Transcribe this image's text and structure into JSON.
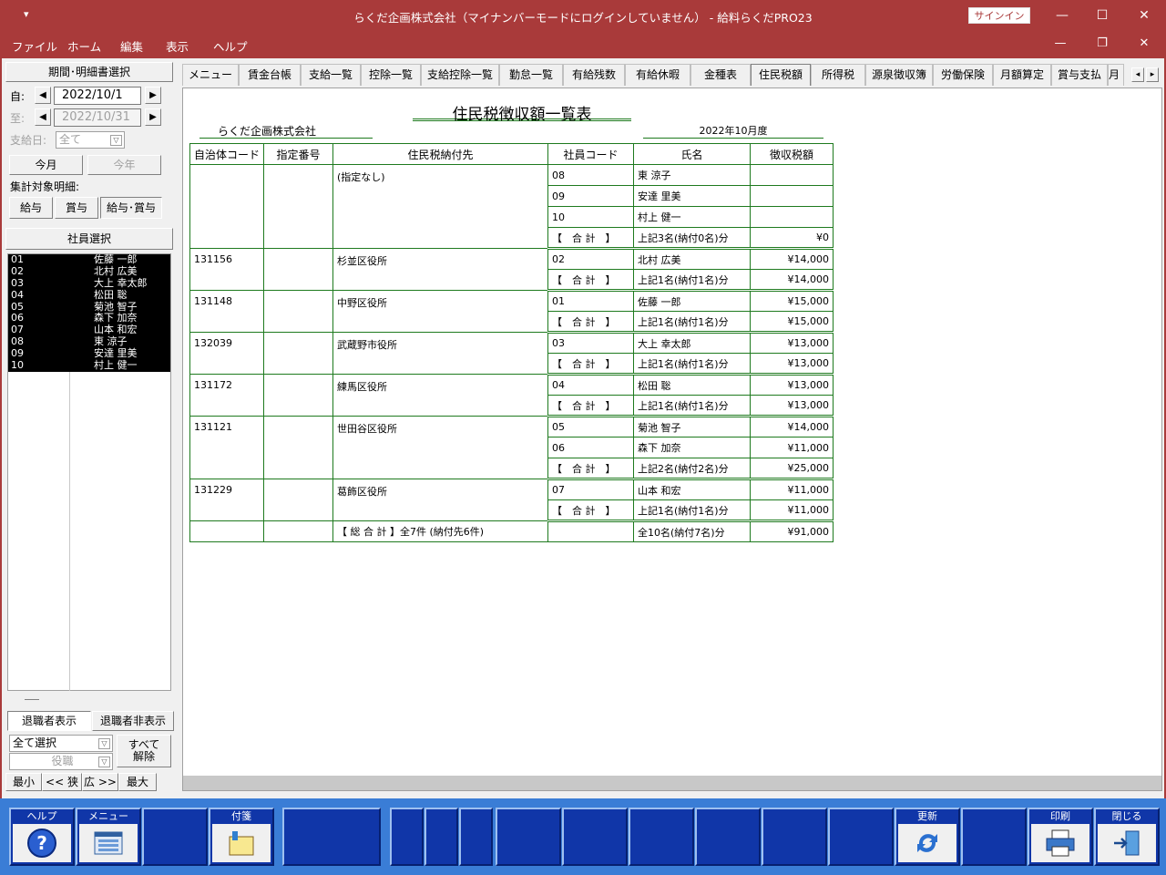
{
  "window": {
    "title": "らくだ企画株式会社（マイナンバーモードにログインしていません） - 給料らくだPRO23",
    "sysmenu": "▾",
    "signin": "サインイン",
    "minimize": "—",
    "maximize": "☐",
    "close": "✕"
  },
  "menu": {
    "items": [
      "ファイル",
      "ホーム",
      "編集",
      "表示",
      "ヘルプ"
    ],
    "minimize": "—",
    "restore": "❐",
    "close": "✕"
  },
  "left": {
    "period_header": "期間･明細書選択",
    "from_label": "自:",
    "from_date": "2022/10/1",
    "to_label": "至:",
    "to_date": "2022/10/31",
    "payday_label": "支給日:",
    "payday_value": "全て",
    "this_month": "今月",
    "this_year": "今年",
    "target_label": "集計対象明細:",
    "btn_salary": "給与",
    "btn_bonus": "賞与",
    "btn_both": "給与･賞与",
    "emp_header": "社員選択",
    "employees": [
      {
        "code": "01",
        "name": "佐藤 一郎"
      },
      {
        "code": "02",
        "name": "北村 広美"
      },
      {
        "code": "03",
        "name": "大上 幸太郎"
      },
      {
        "code": "04",
        "name": "松田 聡"
      },
      {
        "code": "05",
        "name": "菊池 智子"
      },
      {
        "code": "06",
        "name": "森下 加奈"
      },
      {
        "code": "07",
        "name": "山本 和宏"
      },
      {
        "code": "08",
        "name": "東 涼子"
      },
      {
        "code": "09",
        "name": "安達 里美"
      },
      {
        "code": "10",
        "name": "村上 健一"
      }
    ],
    "retired_show": "退職者表示",
    "retired_hide": "退職者非表示",
    "select_all": "全て選択",
    "position": "役職",
    "clear_all_1": "すべて",
    "clear_all_2": "解除",
    "min": "最小",
    "narrow": "<< 狭",
    "wide": "広 >>",
    "max": "最大"
  },
  "tabs": [
    "メニュー",
    "賃金台帳",
    "支給一覧",
    "控除一覧",
    "支給控除一覧",
    "勤怠一覧",
    "有給残数",
    "有給休暇",
    "金種表",
    "住民税額",
    "所得税",
    "源泉徴収簿",
    "労働保険",
    "月額算定",
    "賞与支払",
    "月"
  ],
  "tab_scroll": {
    "left": "◂",
    "right": "▸"
  },
  "report": {
    "title": "住民税徴収額一覧表",
    "company": "らくだ企画株式会社",
    "period": "2022年10月度",
    "headers": [
      "自治体コード",
      "指定番号",
      "住民税納付先",
      "社員コード",
      "氏名",
      "徴収税額"
    ],
    "sum_label": "【　合 計　】",
    "groups": [
      {
        "code": "",
        "dest": "(指定なし)",
        "rows": [
          {
            "emp": "08",
            "name": "東 涼子",
            "tax": ""
          },
          {
            "emp": "09",
            "name": "安達 里美",
            "tax": ""
          },
          {
            "emp": "10",
            "name": "村上 健一",
            "tax": ""
          }
        ],
        "sum_name": "上記3名(納付0名)分",
        "sum_tax": "¥0"
      },
      {
        "code": "131156",
        "dest": "杉並区役所",
        "rows": [
          {
            "emp": "02",
            "name": "北村 広美",
            "tax": "¥14,000"
          }
        ],
        "sum_name": "上記1名(納付1名)分",
        "sum_tax": "¥14,000"
      },
      {
        "code": "131148",
        "dest": "中野区役所",
        "rows": [
          {
            "emp": "01",
            "name": "佐藤 一郎",
            "tax": "¥15,000"
          }
        ],
        "sum_name": "上記1名(納付1名)分",
        "sum_tax": "¥15,000"
      },
      {
        "code": "132039",
        "dest": "武蔵野市役所",
        "rows": [
          {
            "emp": "03",
            "name": "大上 幸太郎",
            "tax": "¥13,000"
          }
        ],
        "sum_name": "上記1名(納付1名)分",
        "sum_tax": "¥13,000"
      },
      {
        "code": "131172",
        "dest": "練馬区役所",
        "rows": [
          {
            "emp": "04",
            "name": "松田 聡",
            "tax": "¥13,000"
          }
        ],
        "sum_name": "上記1名(納付1名)分",
        "sum_tax": "¥13,000"
      },
      {
        "code": "131121",
        "dest": "世田谷区役所",
        "rows": [
          {
            "emp": "05",
            "name": "菊池 智子",
            "tax": "¥14,000"
          },
          {
            "emp": "06",
            "name": "森下 加奈",
            "tax": "¥11,000"
          }
        ],
        "sum_name": "上記2名(納付2名)分",
        "sum_tax": "¥25,000"
      },
      {
        "code": "131229",
        "dest": "葛飾区役所",
        "rows": [
          {
            "emp": "07",
            "name": "山本 和宏",
            "tax": "¥11,000"
          }
        ],
        "sum_name": "上記1名(納付1名)分",
        "sum_tax": "¥11,000"
      }
    ],
    "grand_label": "【 総 合 計 】全7件 (納付先6件)",
    "grand_name": "全10名(納付7名)分",
    "grand_tax": "¥91,000"
  },
  "fkeys": {
    "help": "ヘルプ",
    "menu": "メニュー",
    "tag": "付箋",
    "refresh": "更新",
    "print": "印刷",
    "close": "閉じる"
  },
  "colors": {
    "titlebar": "#a93a3a",
    "fkey_bar": "#3a7dd6",
    "fkey": "#1036a8",
    "table_border": "#1e7a1e"
  }
}
